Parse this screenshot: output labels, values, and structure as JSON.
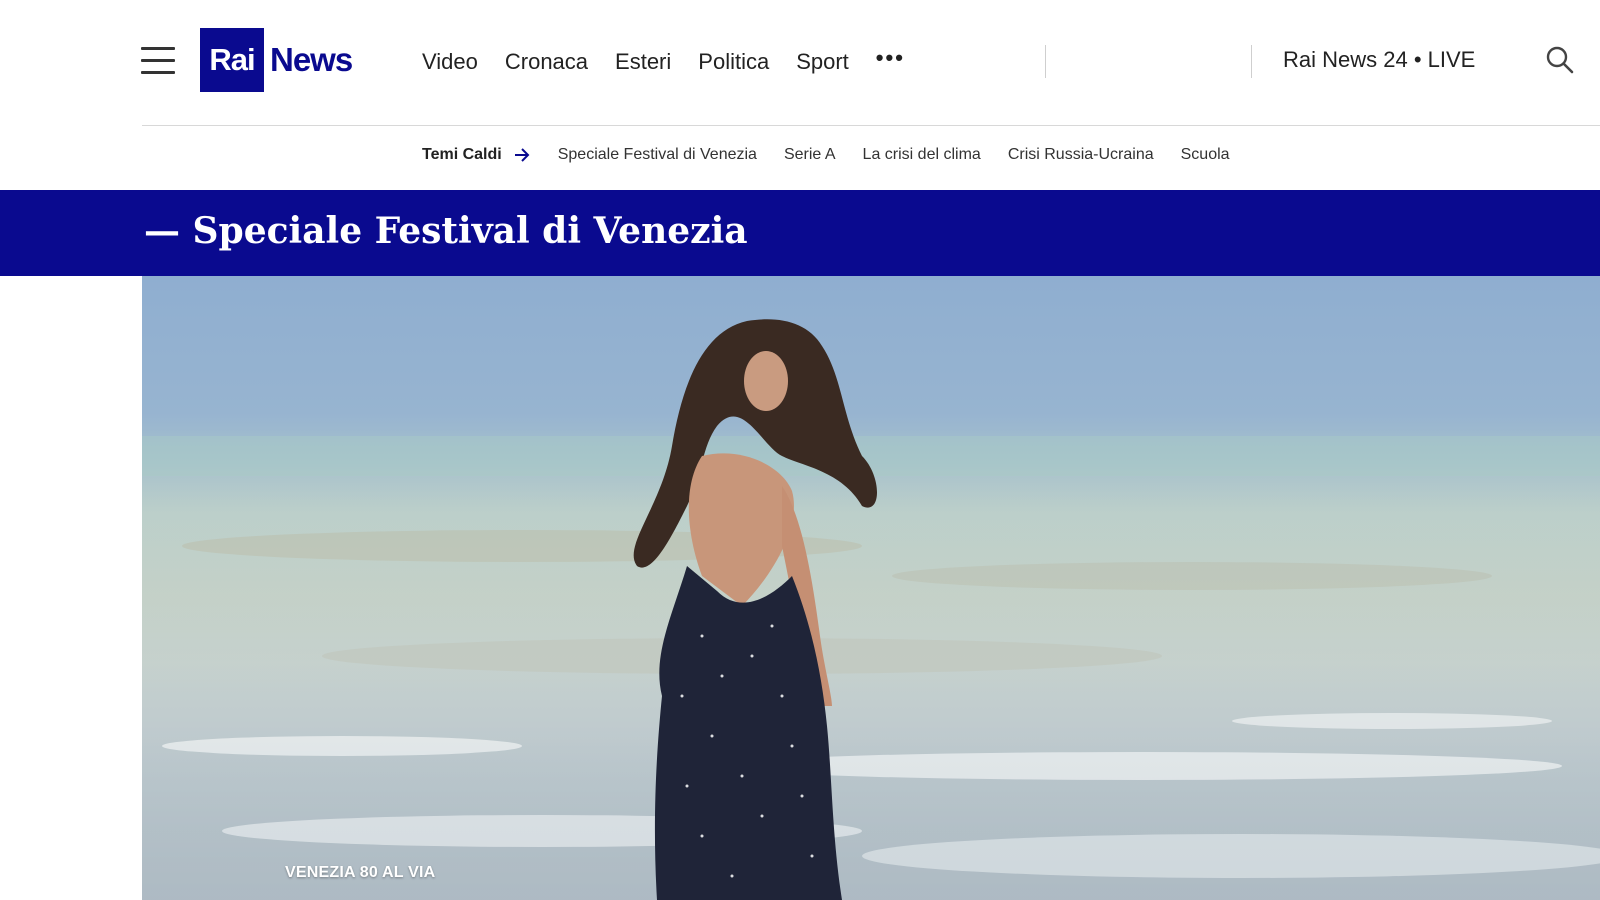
{
  "header": {
    "menu_icon": "hamburger-menu-icon",
    "logo": {
      "box_text": "Rai",
      "text": "News",
      "color": "#0a0a8f"
    },
    "nav": [
      "Video",
      "Cronaca",
      "Esteri",
      "Politica",
      "Sport"
    ],
    "more_label": "•••",
    "live_label": "Rai News 24 • LIVE",
    "search_icon": "search-icon"
  },
  "hot_topics": {
    "label": "Temi Caldi",
    "arrow_icon": "arrow-right-icon",
    "items": [
      "Speciale Festival di Venezia",
      "Serie A",
      "La crisi del clima",
      "Crisi Russia-Ucraina",
      "Scuola"
    ]
  },
  "section": {
    "title": "— Speciale Festival di Venezia",
    "band_color": "#0a0a8f"
  },
  "hero": {
    "caption": "VENEZIA 80 AL VIA"
  }
}
